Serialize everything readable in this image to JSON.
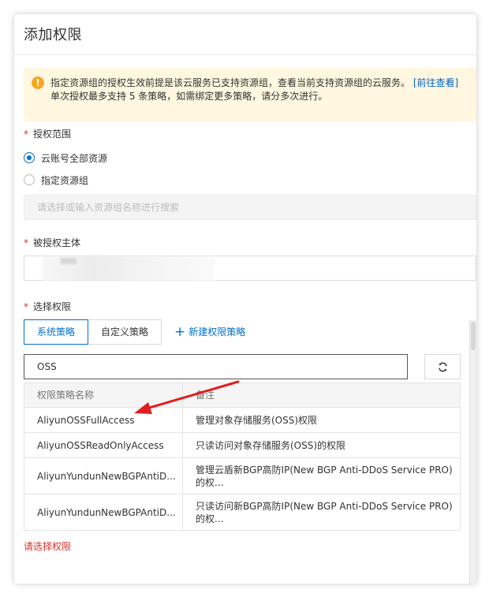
{
  "dialog": {
    "title": "添加权限"
  },
  "notice": {
    "icon": "warning-icon",
    "line1": "指定资源组的授权生效前提是该云服务已支持资源组，查看当前支持资源组的云服务。",
    "link": "[前往查看]",
    "line2": "单次授权最多支持 5 条策略，如需绑定更多策略，请分多次进行。"
  },
  "scope": {
    "required_mark": "*",
    "label": "授权范围",
    "options": [
      {
        "label": "云账号全部资源",
        "checked": true
      },
      {
        "label": "指定资源组",
        "checked": false
      }
    ],
    "resource_group_placeholder": "请选择或输入资源组名称进行搜索"
  },
  "subject": {
    "required_mark": "*",
    "label": "被授权主体",
    "value": ""
  },
  "permissions": {
    "required_mark": "*",
    "label": "选择权限",
    "tabs": [
      {
        "label": "系统策略",
        "active": true
      },
      {
        "label": "自定义策略",
        "active": false
      }
    ],
    "new_policy_label": "新建权限策略",
    "search_value": "OSS",
    "table": {
      "headers": [
        "权限策略名称",
        "备注"
      ],
      "rows": [
        {
          "name": "AliyunOSSFullAccess",
          "note": "管理对象存储服务(OSS)权限"
        },
        {
          "name": "AliyunOSSReadOnlyAccess",
          "note": "只读访问对象存储服务(OSS)的权限"
        },
        {
          "name": "AliyunYundunNewBGPAntiD...",
          "note": "管理云盾新BGP高防IP(New BGP Anti-DDoS Service PRO)的权..."
        },
        {
          "name": "AliyunYundunNewBGPAntiD...",
          "note": "只读访问新BGP高防IP(New BGP Anti-DDoS Service PRO)的权..."
        }
      ]
    },
    "error": "请选择权限"
  },
  "colors": {
    "accent": "#0070cc",
    "error": "#d93026",
    "notice_bg": "#fff7df",
    "annotation_arrow": "#e02020"
  }
}
